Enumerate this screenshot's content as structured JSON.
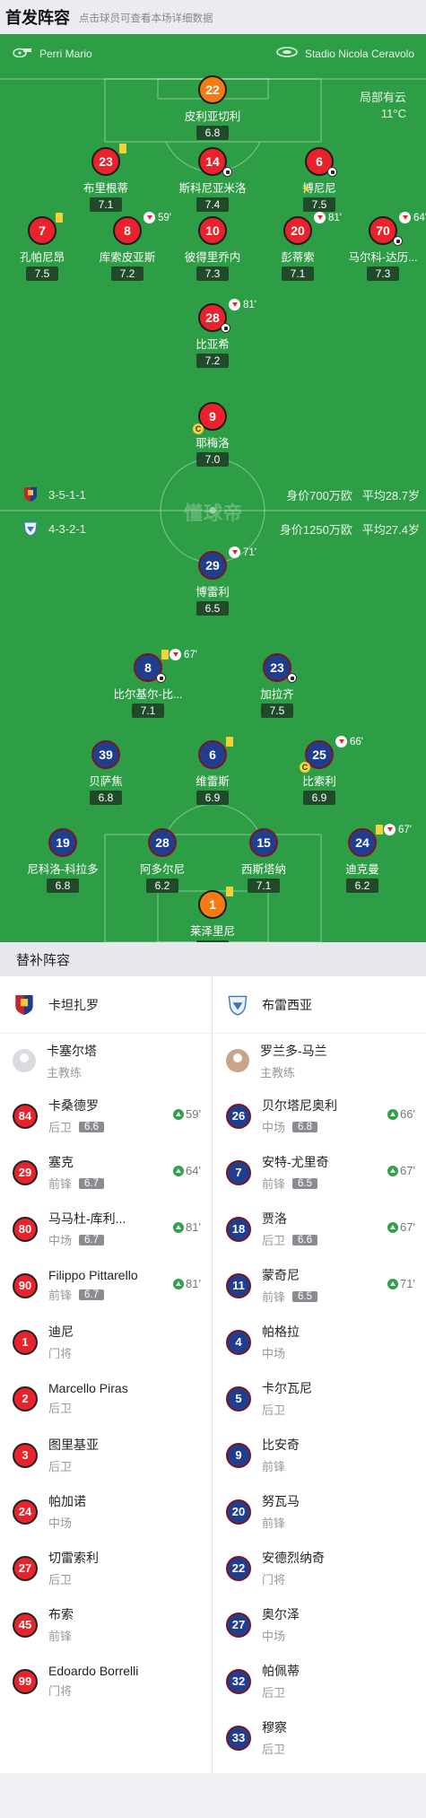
{
  "header": {
    "title": "首发阵容",
    "hint": "点击球员可查看本场详细数据"
  },
  "pitch": {
    "referee": "Perri Mario",
    "stadium": "Stadio Nicola Ceravolo",
    "weather": "局部有云",
    "temperature": "11°C",
    "watermark": "懂球帝",
    "home": {
      "formation": "3-5-1-1",
      "value": "身价700万欧",
      "avg_age": "平均28.7岁"
    },
    "away": {
      "formation": "4-3-2-1",
      "value": "身价1250万欧",
      "avg_age": "平均27.4岁"
    }
  },
  "home_players": [
    {
      "num": "22",
      "name": "皮利亚切利",
      "rating": "6.8",
      "gk": true
    },
    {
      "num": "23",
      "name": "布里根蒂",
      "rating": "7.1",
      "yellow": true
    },
    {
      "num": "14",
      "name": "斯科尼亚米洛",
      "rating": "7.4",
      "assist": true
    },
    {
      "num": "6",
      "name": "博尼尼",
      "rating": "7.5",
      "goal": true,
      "star": true
    },
    {
      "num": "7",
      "name": "孔帕尼昂",
      "rating": "7.5",
      "yellow": true
    },
    {
      "num": "8",
      "name": "库索皮亚斯",
      "rating": "7.2",
      "sub_min": "59'"
    },
    {
      "num": "10",
      "name": "彼得里乔内",
      "rating": "7.3"
    },
    {
      "num": "20",
      "name": "彭蒂索",
      "rating": "7.1",
      "sub_min": "81'"
    },
    {
      "num": "70",
      "name": "马尔科-达历...",
      "rating": "7.3",
      "sub_min": "64'",
      "assist": true
    },
    {
      "num": "28",
      "name": "比亚希",
      "rating": "7.2",
      "sub_min": "81'",
      "goal": true
    },
    {
      "num": "9",
      "name": "耶梅洛",
      "rating": "7.0",
      "captain": true
    }
  ],
  "away_players": [
    {
      "num": "29",
      "name": "博雷利",
      "rating": "6.5",
      "sub_min": "71'"
    },
    {
      "num": "8",
      "name": "比尔基尔-比...",
      "rating": "7.1",
      "sub_min": "67'",
      "yellow": true,
      "goal": true
    },
    {
      "num": "23",
      "name": "加拉齐",
      "rating": "7.5",
      "assist": true
    },
    {
      "num": "39",
      "name": "贝萨焦",
      "rating": "6.8"
    },
    {
      "num": "6",
      "name": "维雷斯",
      "rating": "6.9",
      "yellow": true
    },
    {
      "num": "25",
      "name": "比索利",
      "rating": "6.9",
      "sub_min": "66'",
      "captain": true
    },
    {
      "num": "19",
      "name": "尼科洛-科拉多",
      "rating": "6.8"
    },
    {
      "num": "28",
      "name": "阿多尔尼",
      "rating": "6.2"
    },
    {
      "num": "15",
      "name": "西斯塔纳",
      "rating": "7.1"
    },
    {
      "num": "24",
      "name": "迪克曼",
      "rating": "6.2",
      "sub_min": "67'",
      "yellow": true
    },
    {
      "num": "1",
      "name": "莱泽里尼",
      "rating": "6.7",
      "gk": true,
      "yellow": true
    }
  ],
  "subs": {
    "title": "替补阵容",
    "home": {
      "team": "卡坦扎罗",
      "coach": {
        "name": "卡塞尔塔",
        "role": "主教练"
      },
      "players": [
        {
          "num": "84",
          "name": "卡桑德罗",
          "pos": "后卫",
          "rating": "6.6",
          "min": "59'"
        },
        {
          "num": "29",
          "name": "塞克",
          "pos": "前锋",
          "rating": "6.7",
          "min": "64'"
        },
        {
          "num": "80",
          "name": "马马杜-库利...",
          "pos": "中场",
          "rating": "6.7",
          "min": "81'"
        },
        {
          "num": "90",
          "name": "Filippo Pittarello",
          "pos": "前锋",
          "rating": "6.7",
          "min": "81'"
        },
        {
          "num": "1",
          "name": "迪尼",
          "pos": "门将"
        },
        {
          "num": "2",
          "name": "Marcello Piras",
          "pos": "后卫"
        },
        {
          "num": "3",
          "name": "图里基亚",
          "pos": "后卫"
        },
        {
          "num": "24",
          "name": "帕加诺",
          "pos": "中场"
        },
        {
          "num": "27",
          "name": "切雷索利",
          "pos": "后卫"
        },
        {
          "num": "45",
          "name": "布索",
          "pos": "前锋"
        },
        {
          "num": "99",
          "name": "Edoardo Borrelli",
          "pos": "门将"
        }
      ]
    },
    "away": {
      "team": "布雷西亚",
      "coach": {
        "name": "罗兰多-马兰",
        "role": "主教练"
      },
      "players": [
        {
          "num": "26",
          "name": "贝尔塔尼奥利",
          "pos": "中场",
          "rating": "6.8",
          "min": "66'"
        },
        {
          "num": "7",
          "name": "安特-尤里奇",
          "pos": "前锋",
          "rating": "6.5",
          "min": "67'"
        },
        {
          "num": "18",
          "name": "贾洛",
          "pos": "后卫",
          "rating": "6.6",
          "min": "67'"
        },
        {
          "num": "11",
          "name": "蒙奇尼",
          "pos": "前锋",
          "rating": "6.5",
          "min": "71'"
        },
        {
          "num": "4",
          "name": "帕格拉",
          "pos": "中场"
        },
        {
          "num": "5",
          "name": "卡尔瓦尼",
          "pos": "后卫"
        },
        {
          "num": "9",
          "name": "比安奇",
          "pos": "前锋"
        },
        {
          "num": "20",
          "name": "努瓦马",
          "pos": "前锋"
        },
        {
          "num": "22",
          "name": "安德烈纳奇",
          "pos": "门将"
        },
        {
          "num": "27",
          "name": "奥尔泽",
          "pos": "中场"
        },
        {
          "num": "32",
          "name": "帕佩蒂",
          "pos": "后卫"
        },
        {
          "num": "33",
          "name": "穆察",
          "pos": "后卫"
        }
      ]
    }
  },
  "colors": {
    "pitch": "#2e9e46",
    "home": "#e8232b",
    "away": "#1f3f8e",
    "gk": "#f77b14",
    "sub_up": "#2fa24a"
  }
}
